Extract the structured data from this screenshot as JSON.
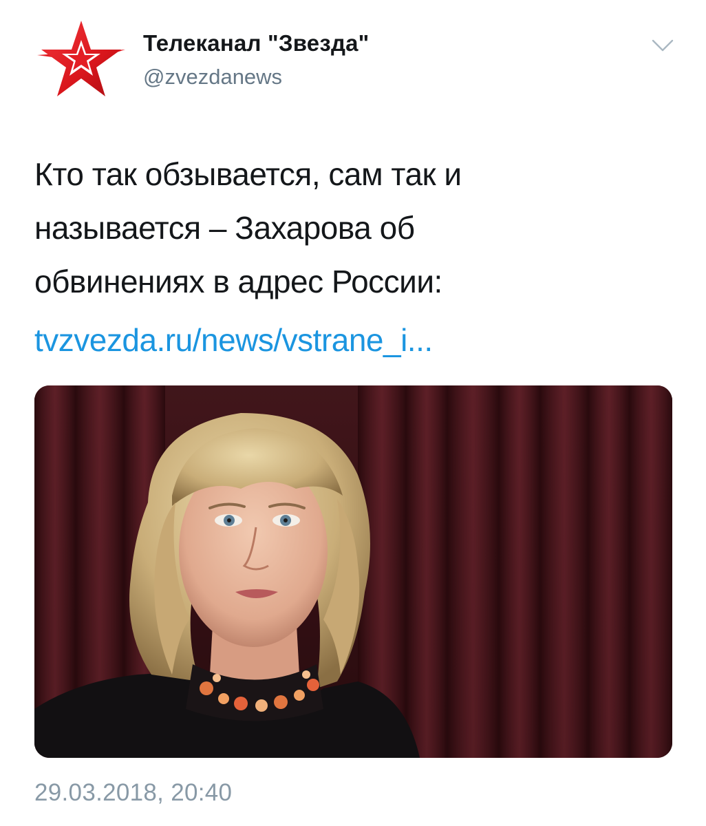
{
  "tweet": {
    "author_name": "Телеканал \"Звезда\"",
    "author_handle": "@zvezdanews",
    "text_lines": [
      "Кто так обзывается, сам так и",
      "называется – Захарова об",
      "обвинениях в адрес России:"
    ],
    "link_text": "tvzvezda.ru/news/vstrane_i...",
    "timestamp": "29.03.2018, 20:40"
  },
  "icons": {
    "avatar": "zvezda-star-logo",
    "menu": "chevron-down-icon"
  },
  "colors": {
    "brand_red": "#e31e24",
    "link": "#1b95e0",
    "muted": "#657786",
    "timestamp": "#8899a6",
    "text": "#14171a"
  }
}
